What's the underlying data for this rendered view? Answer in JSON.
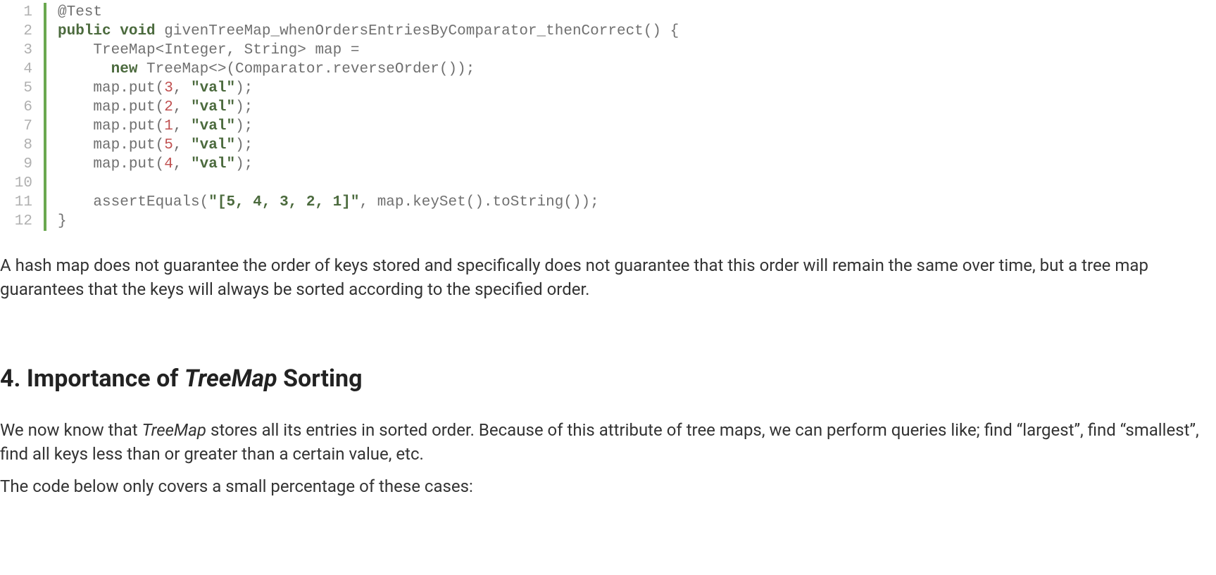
{
  "code": {
    "lines": [
      {
        "n": "1",
        "tokens": [
          {
            "t": "@Test",
            "c": "ann"
          }
        ]
      },
      {
        "n": "2",
        "tokens": [
          {
            "t": "public",
            "c": "kw"
          },
          {
            "t": " ",
            "c": "plain"
          },
          {
            "t": "void",
            "c": "kw"
          },
          {
            "t": " givenTreeMap_whenOrdersEntriesByComparator_thenCorrect() {",
            "c": "plain"
          }
        ]
      },
      {
        "n": "3",
        "tokens": [
          {
            "t": "    TreeMap<Integer, String> map =",
            "c": "plain"
          }
        ]
      },
      {
        "n": "4",
        "tokens": [
          {
            "t": "      ",
            "c": "plain"
          },
          {
            "t": "new",
            "c": "kw"
          },
          {
            "t": " TreeMap<>(Comparator.reverseOrder());",
            "c": "plain"
          }
        ]
      },
      {
        "n": "5",
        "tokens": [
          {
            "t": "    map.put(",
            "c": "plain"
          },
          {
            "t": "3",
            "c": "num"
          },
          {
            "t": ", ",
            "c": "plain"
          },
          {
            "t": "\"val\"",
            "c": "str"
          },
          {
            "t": ");",
            "c": "plain"
          }
        ]
      },
      {
        "n": "6",
        "tokens": [
          {
            "t": "    map.put(",
            "c": "plain"
          },
          {
            "t": "2",
            "c": "num"
          },
          {
            "t": ", ",
            "c": "plain"
          },
          {
            "t": "\"val\"",
            "c": "str"
          },
          {
            "t": ");",
            "c": "plain"
          }
        ]
      },
      {
        "n": "7",
        "tokens": [
          {
            "t": "    map.put(",
            "c": "plain"
          },
          {
            "t": "1",
            "c": "num"
          },
          {
            "t": ", ",
            "c": "plain"
          },
          {
            "t": "\"val\"",
            "c": "str"
          },
          {
            "t": ");",
            "c": "plain"
          }
        ]
      },
      {
        "n": "8",
        "tokens": [
          {
            "t": "    map.put(",
            "c": "plain"
          },
          {
            "t": "5",
            "c": "num"
          },
          {
            "t": ", ",
            "c": "plain"
          },
          {
            "t": "\"val\"",
            "c": "str"
          },
          {
            "t": ");",
            "c": "plain"
          }
        ]
      },
      {
        "n": "9",
        "tokens": [
          {
            "t": "    map.put(",
            "c": "plain"
          },
          {
            "t": "4",
            "c": "num"
          },
          {
            "t": ", ",
            "c": "plain"
          },
          {
            "t": "\"val\"",
            "c": "str"
          },
          {
            "t": ");",
            "c": "plain"
          }
        ]
      },
      {
        "n": "10",
        "tokens": [
          {
            "t": "",
            "c": "plain"
          }
        ]
      },
      {
        "n": "11",
        "tokens": [
          {
            "t": "    assertEquals(",
            "c": "plain"
          },
          {
            "t": "\"[5, 4, 3, 2, 1]\"",
            "c": "str"
          },
          {
            "t": ", map.keySet().toString());",
            "c": "plain"
          }
        ]
      },
      {
        "n": "12",
        "tokens": [
          {
            "t": "}",
            "c": "plain"
          }
        ]
      }
    ]
  },
  "paragraph1": "A hash map does not guarantee the order of keys stored and specifically does not guarantee that this order will remain the same over time, but a tree map guarantees that the keys will always be sorted according to the specified order.",
  "sectionHeading": {
    "prefix": "4. Importance of ",
    "italic": "TreeMap",
    "suffix": " Sorting"
  },
  "paragraph2": {
    "p1_before": "We now know that ",
    "p1_italic": "TreeMap",
    "p1_after": " stores all its entries in sorted order. Because of this attribute of tree maps, we can perform queries like; find “largest”, find “smallest”, find all keys less than or greater than a certain value, etc."
  },
  "paragraph3": "The code below only covers a small percentage of these cases:"
}
